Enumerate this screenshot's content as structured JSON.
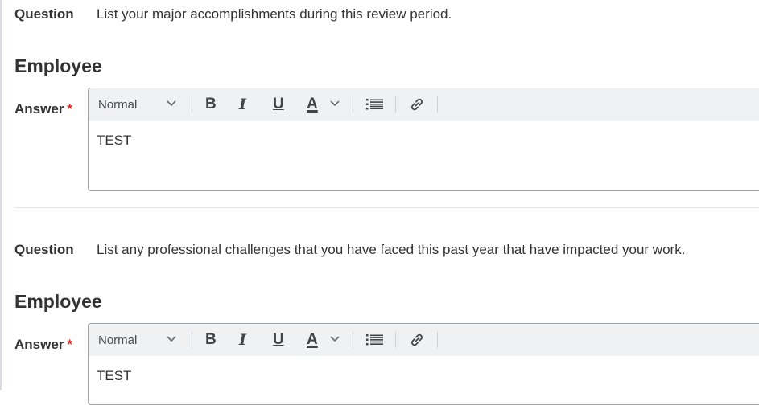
{
  "questions": [
    {
      "question_label": "Question",
      "question_text": "List your major accomplishments during this review period.",
      "role_heading": "Employee",
      "answer_label": "Answer",
      "required_marker": "*",
      "toolbar": {
        "style_value": "Normal",
        "bold": "B",
        "italic": "I",
        "underline": "U",
        "text_color": "A"
      },
      "answer_value": "TEST"
    },
    {
      "question_label": "Question",
      "question_text": "List any professional challenges that you have faced this past year that have impacted your work.",
      "role_heading": "Employee",
      "answer_label": "Answer",
      "required_marker": "*",
      "toolbar": {
        "style_value": "Normal",
        "bold": "B",
        "italic": "I",
        "underline": "U",
        "text_color": "A"
      },
      "answer_value": "TEST"
    }
  ],
  "icons": {
    "style_dropdown": "chevron-down-icon",
    "color_dropdown": "chevron-down-icon",
    "list": "bullet-list-icon",
    "link": "link-icon"
  },
  "colors": {
    "required": "#de2e21",
    "toolbar_bg": "#f0f1f2",
    "editor_border": "#9aa4ad"
  }
}
